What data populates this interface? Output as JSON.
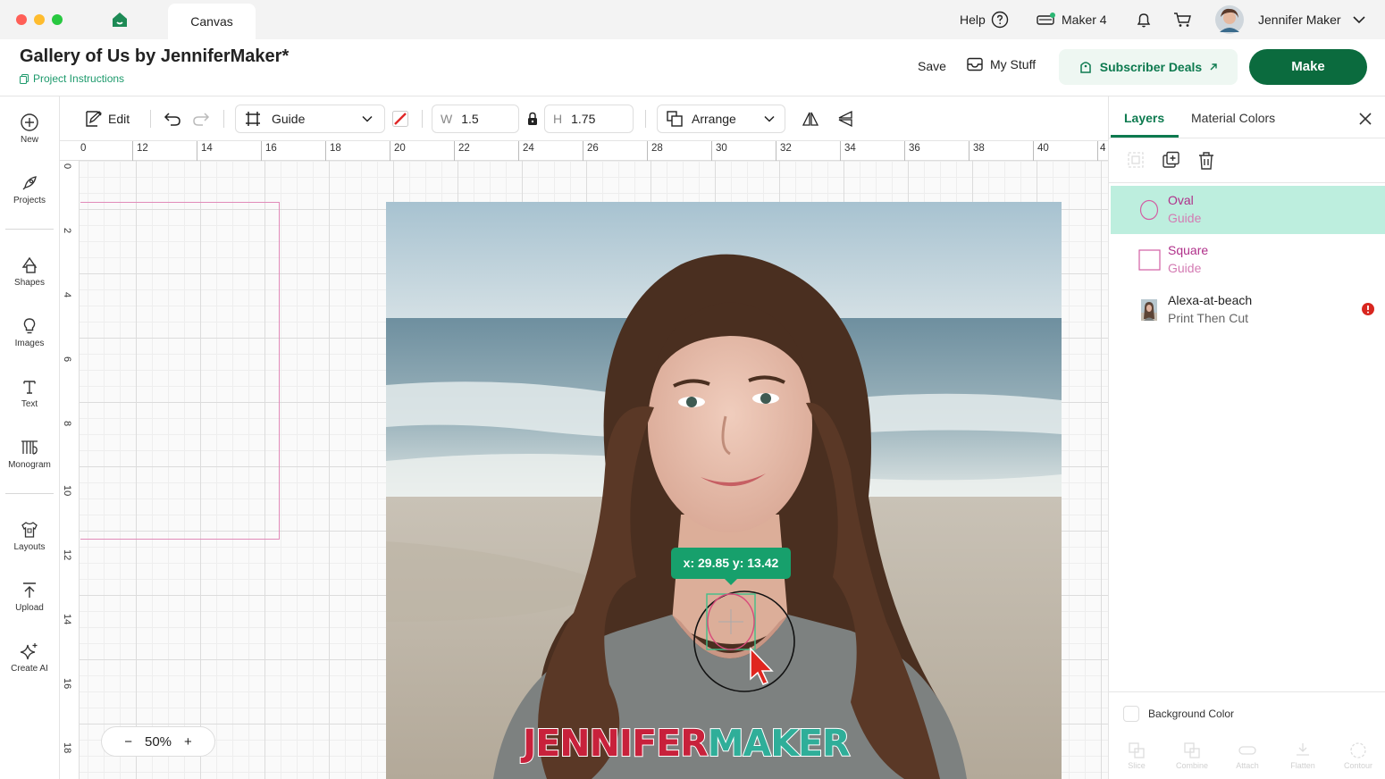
{
  "window": {
    "tab_label": "Canvas",
    "help_label": "Help",
    "machine_label": "Maker 4",
    "user_name": "Jennifer Maker"
  },
  "header": {
    "project_title": "Gallery of Us by JenniferMaker*",
    "project_instructions": "Project Instructions",
    "save_label": "Save",
    "mystuff_label": "My Stuff",
    "deals_label": "Subscriber Deals",
    "make_label": "Make"
  },
  "sidebar": {
    "items": [
      {
        "label": "New",
        "icon": "plus-circle-icon"
      },
      {
        "label": "Projects",
        "icon": "rocket-icon"
      },
      {
        "label": "Shapes",
        "icon": "shapes-icon"
      },
      {
        "label": "Images",
        "icon": "lightbulb-icon"
      },
      {
        "label": "Text",
        "icon": "text-icon"
      },
      {
        "label": "Monogram",
        "icon": "monogram-icon"
      },
      {
        "label": "Layouts",
        "icon": "shirt-icon"
      },
      {
        "label": "Upload",
        "icon": "upload-icon"
      },
      {
        "label": "Create AI",
        "icon": "sparkle-icon"
      }
    ]
  },
  "toolbar": {
    "edit_label": "Edit",
    "operation_value": "Guide",
    "width_label": "W",
    "width_value": "1.5",
    "height_label": "H",
    "height_value": "1.75",
    "arrange_label": "Arrange"
  },
  "canvas": {
    "ruler_top": [
      "0",
      "12",
      "14",
      "16",
      "18",
      "20",
      "22",
      "24",
      "26",
      "28",
      "30",
      "32",
      "34",
      "36",
      "38",
      "40",
      "4"
    ],
    "ruler_left": [
      "0",
      "2",
      "4",
      "6",
      "8",
      "10",
      "12",
      "14",
      "16",
      "18"
    ],
    "coord_readout": "x: 29.85 y: 13.42",
    "zoom_value": "50%",
    "zoom_minus": "−",
    "zoom_plus": "+",
    "watermark_a": "JENNIFER",
    "watermark_b": "MAKER"
  },
  "right_panel": {
    "tabs": [
      "Layers",
      "Material Colors"
    ],
    "layers": [
      {
        "name": "Oval",
        "sub": "Guide",
        "selected": true
      },
      {
        "name": "Square",
        "sub": "Guide",
        "selected": false
      },
      {
        "name": "Alexa-at-beach",
        "sub": "Print Then Cut",
        "selected": false,
        "warning": true
      }
    ],
    "background_color_label": "Background Color",
    "bottom_actions": [
      "Slice",
      "Combine",
      "Attach",
      "Flatten",
      "Contour"
    ]
  },
  "colors": {
    "brand_green": "#0b6b3e",
    "accent_green": "#17a06c",
    "guide_pink": "#c8369a",
    "selected_layer_bg": "#bdeede"
  }
}
